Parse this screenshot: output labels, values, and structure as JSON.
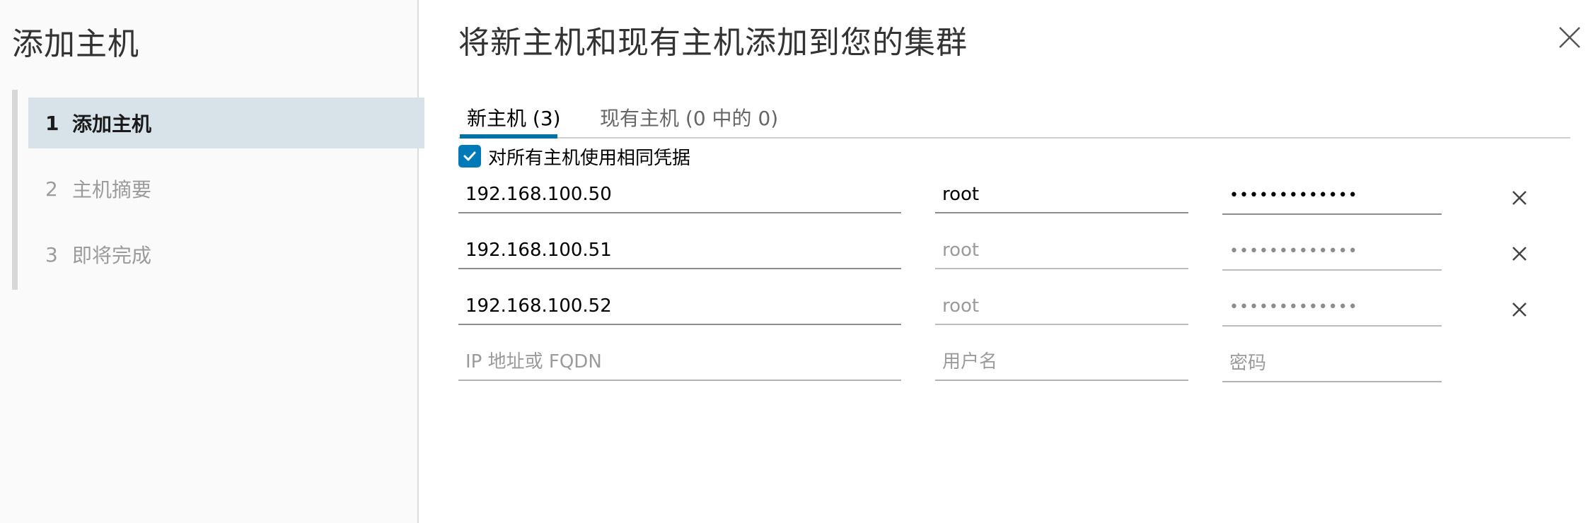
{
  "sidebar": {
    "title": "添加主机",
    "steps": [
      {
        "num": "1",
        "label": "添加主机"
      },
      {
        "num": "2",
        "label": "主机摘要"
      },
      {
        "num": "3",
        "label": "即将完成"
      }
    ]
  },
  "dialog": {
    "title": "将新主机和现有主机添加到您的集群",
    "close_icon": "close-icon"
  },
  "tabs": [
    {
      "label": "新主机 (3)"
    },
    {
      "label": "现有主机 (0 中的 0)"
    }
  ],
  "same_credentials": {
    "label": "对所有主机使用相同凭据",
    "checked": true
  },
  "hosts": [
    {
      "address": "192.168.100.50",
      "username": "root",
      "password": "•••••••••••••"
    },
    {
      "address": "192.168.100.51",
      "username": "root",
      "password": "•••••••••••••"
    },
    {
      "address": "192.168.100.52",
      "username": "root",
      "password": "•••••••••••••"
    }
  ],
  "new_host": {
    "address_placeholder": "IP 地址或 FQDN",
    "username_placeholder": "用户名",
    "password_placeholder": "密码"
  },
  "colors": {
    "accent": "#0072a3",
    "checkbox": "#0079b8",
    "active_step_bg": "#d8e3e9"
  }
}
